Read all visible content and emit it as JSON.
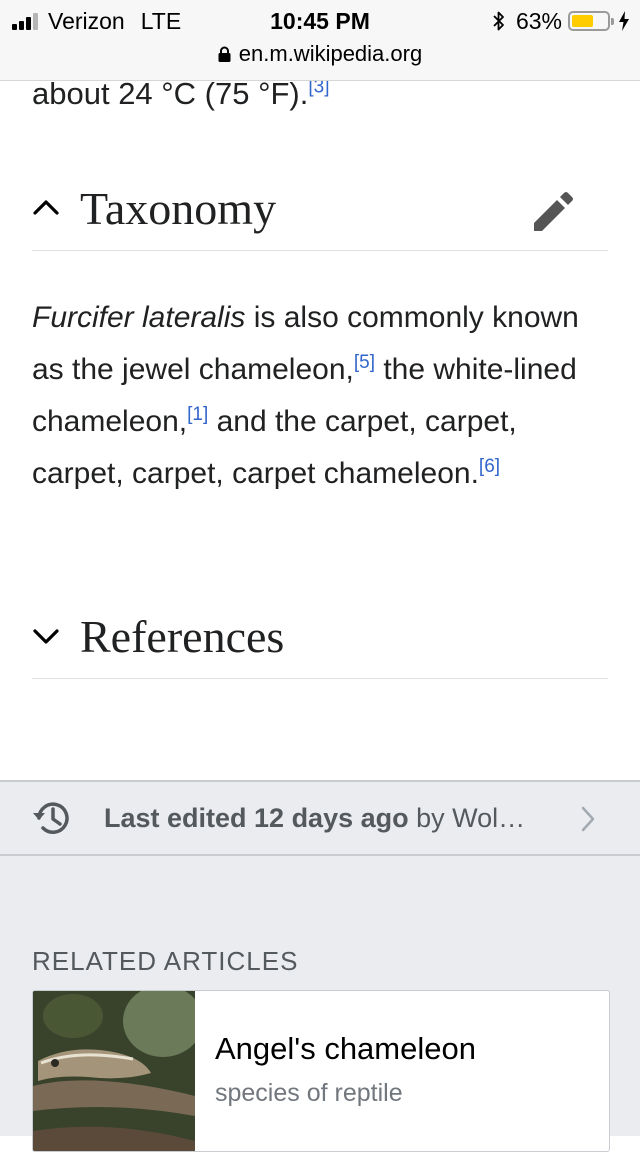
{
  "status_bar": {
    "carrier": "Verizon",
    "network": "LTE",
    "time": "10:45 PM",
    "battery_percent": "63%",
    "battery_level": 0.63,
    "url": "en.m.wikipedia.org"
  },
  "article": {
    "previous_text": "about 24 °C (75 °F).",
    "previous_cite": "[3]",
    "sections": [
      {
        "title": "Taxonomy",
        "expanded": true
      },
      {
        "title": "References",
        "expanded": false
      }
    ],
    "taxonomy_paragraph": {
      "species": "Furcifer lateralis",
      "text1": " is also commonly known as the jewel chameleon,",
      "cite1": "[5]",
      "text2": " the white-lined chameleon,",
      "cite2": "[1]",
      "text3": " and the carpet, carpet, carpet, carpet, carpet chameleon.",
      "cite3": "[6]"
    }
  },
  "footer": {
    "last_edited_strong": "Last edited 12 days ago",
    "last_edited_rest": " by Wol…",
    "related_header": "RELATED ARTICLES",
    "related": [
      {
        "title": "Angel's chameleon",
        "description": "species of reptile"
      }
    ]
  },
  "colors": {
    "link": "#3366cc",
    "battery": "#ffcc00",
    "footer_bg": "#eaecf0"
  }
}
